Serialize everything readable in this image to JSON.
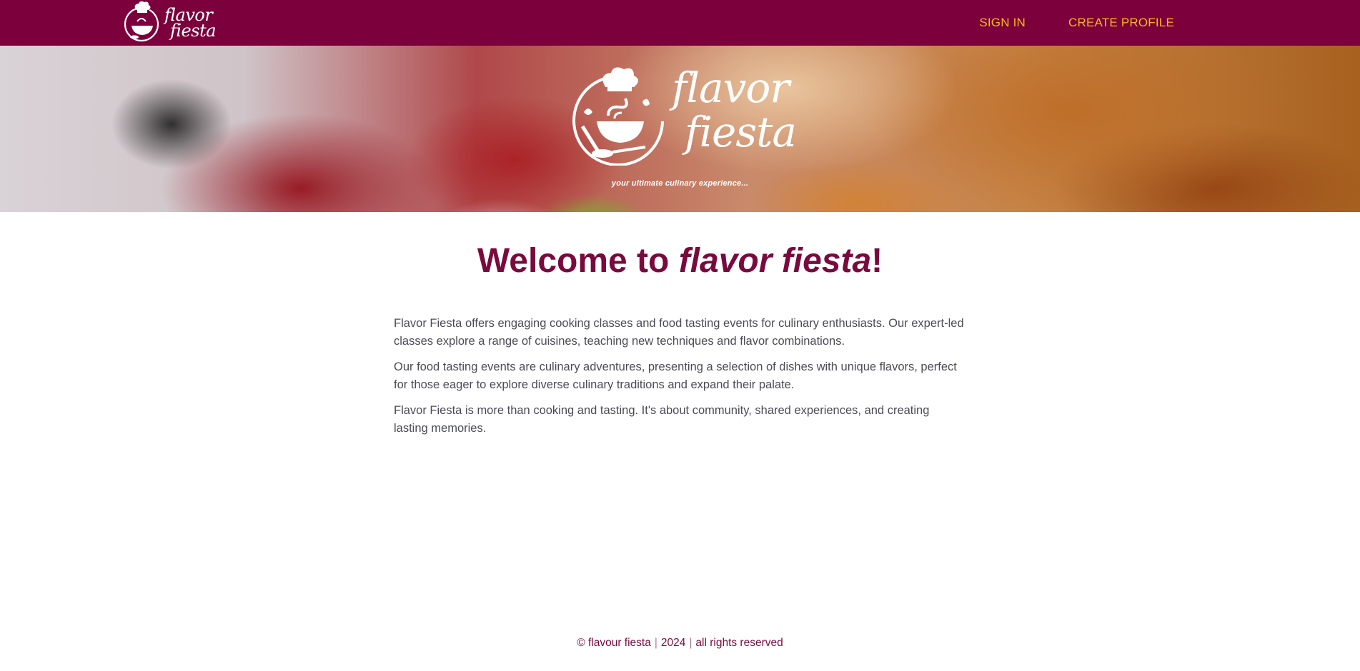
{
  "header": {
    "logo_line1": "flavor",
    "logo_line2": "fiesta",
    "nav": {
      "signin": "SIGN IN",
      "create_profile": "CREATE PROFILE"
    }
  },
  "hero": {
    "logo_line1": "flavor",
    "logo_line2": "fiesta",
    "tagline": "your ultimate culinary experience..."
  },
  "main": {
    "heading_prefix": "Welcome to ",
    "heading_brand": "flavor fiesta",
    "heading_suffix": "!",
    "paragraphs": [
      "Flavor Fiesta offers engaging cooking classes and food tasting events for culinary enthusiasts. Our expert-led classes explore a range of cuisines, teaching new techniques and flavor combinations.",
      "Our food tasting events are culinary adventures, presenting a selection of dishes with unique flavors, perfect for those eager to explore diverse culinary traditions and expand their palate.",
      "Flavor Fiesta is more than cooking and tasting. It's about community, shared experiences, and creating lasting memories."
    ]
  },
  "footer": {
    "part1": "© flavour fiesta",
    "part2": "2024",
    "part3": "all rights reserved",
    "separator": "|"
  },
  "colors": {
    "brand": "#7c003c",
    "nav_link": "#f5b820",
    "heading": "#7a0a3e"
  }
}
